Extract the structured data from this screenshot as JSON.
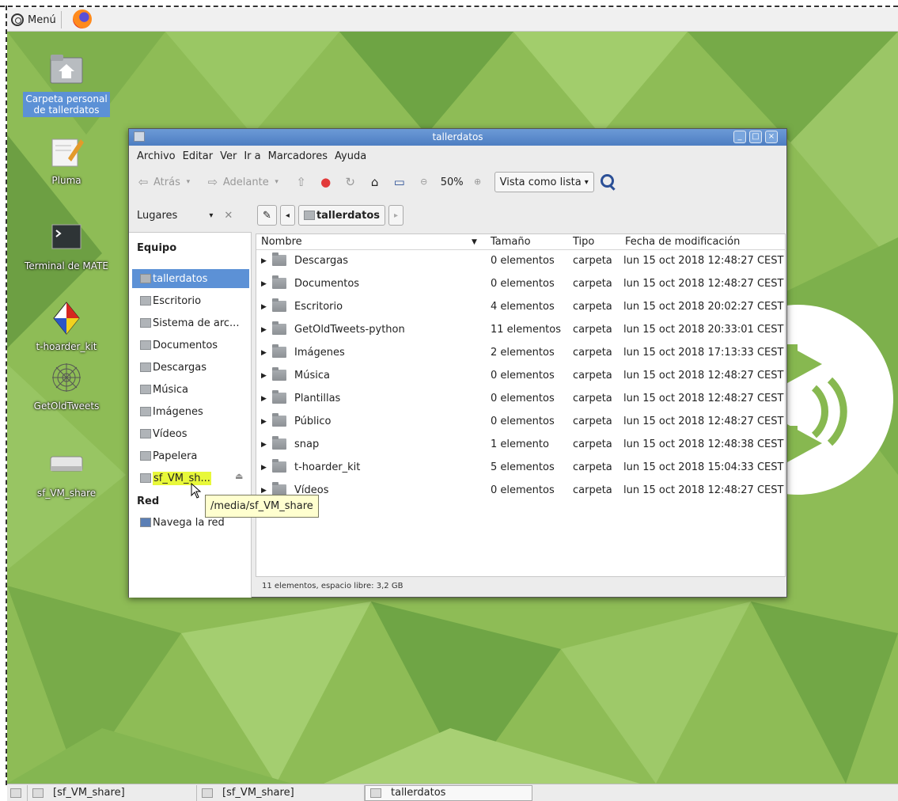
{
  "top_panel": {
    "menu_label": "Menú",
    "icons": [
      "mate-menu-icon",
      "firefox-icon"
    ]
  },
  "desktop": {
    "icons": [
      {
        "id": "home",
        "label_1": "Carpeta personal",
        "label_2": "de tallerdatos",
        "icon": "home-folder-icon"
      },
      {
        "id": "pluma",
        "label_1": "Pluma",
        "icon": "text-editor-icon"
      },
      {
        "id": "terminal",
        "label_1": "Terminal de MATE",
        "icon": "terminal-icon"
      },
      {
        "id": "thoarder",
        "label_1": "t-hoarder_kit",
        "icon": "kite-icon"
      },
      {
        "id": "getold",
        "label_1": "GetOldTweets",
        "icon": "web-icon"
      },
      {
        "id": "share",
        "label_1": "sf_VM_share",
        "icon": "drive-icon"
      }
    ]
  },
  "window": {
    "title": "tallerdatos",
    "menu": [
      "Archivo",
      "Editar",
      "Ver",
      "Ir a",
      "Marcadores",
      "Ayuda"
    ],
    "toolbar": {
      "back": "Atrás",
      "forward": "Adelante",
      "zoom": "50%",
      "view": "Vista como lista"
    },
    "sidebar": {
      "header": "Lugares",
      "section_equipo": "Equipo",
      "items": [
        "tallerdatos",
        "Escritorio",
        "Sistema de arc...",
        "Documentos",
        "Descargas",
        "Música",
        "Imágenes",
        "Vídeos",
        "Papelera",
        "sf_VM_sh..."
      ],
      "section_red": "Red",
      "network_item": "Navega la red"
    },
    "pathbar": {
      "crumb": "tallerdatos"
    },
    "columns": [
      "Nombre",
      "Tamaño",
      "Tipo",
      "Fecha de modificación"
    ],
    "files": [
      {
        "name": "Descargas",
        "size": "0 elementos",
        "type": "carpeta",
        "date": "lun 15 oct 2018 12:48:27 CEST"
      },
      {
        "name": "Documentos",
        "size": "0 elementos",
        "type": "carpeta",
        "date": "lun 15 oct 2018 12:48:27 CEST"
      },
      {
        "name": "Escritorio",
        "size": "4 elementos",
        "type": "carpeta",
        "date": "lun 15 oct 2018 20:02:27 CEST"
      },
      {
        "name": "GetOldTweets-python",
        "size": "11 elementos",
        "type": "carpeta",
        "date": "lun 15 oct 2018 20:33:01 CEST"
      },
      {
        "name": "Imágenes",
        "size": "2 elementos",
        "type": "carpeta",
        "date": "lun 15 oct 2018 17:13:33 CEST"
      },
      {
        "name": "Música",
        "size": "0 elementos",
        "type": "carpeta",
        "date": "lun 15 oct 2018 12:48:27 CEST"
      },
      {
        "name": "Plantillas",
        "size": "0 elementos",
        "type": "carpeta",
        "date": "lun 15 oct 2018 12:48:27 CEST"
      },
      {
        "name": "Público",
        "size": "0 elementos",
        "type": "carpeta",
        "date": "lun 15 oct 2018 12:48:27 CEST"
      },
      {
        "name": "snap",
        "size": "1 elemento",
        "type": "carpeta",
        "date": "lun 15 oct 2018 12:48:38 CEST"
      },
      {
        "name": "t-hoarder_kit",
        "size": "5 elementos",
        "type": "carpeta",
        "date": "lun 15 oct 2018 15:04:33 CEST"
      },
      {
        "name": "Vídeos",
        "size": "0 elementos",
        "type": "carpeta",
        "date": "lun 15 oct 2018 12:48:27 CEST"
      }
    ],
    "status": "11 elementos, espacio libre: 3,2 GB",
    "tooltip": "/media/sf_VM_share"
  },
  "taskbar": {
    "tasks": [
      "[sf_VM_share]",
      "[sf_VM_share]",
      "tallerdatos"
    ]
  },
  "colors": {
    "selection": "#5c91d6",
    "titlebar": "#4d7ec2",
    "desktop_green": "#8dbb54",
    "highlight": "#e8f83a"
  }
}
